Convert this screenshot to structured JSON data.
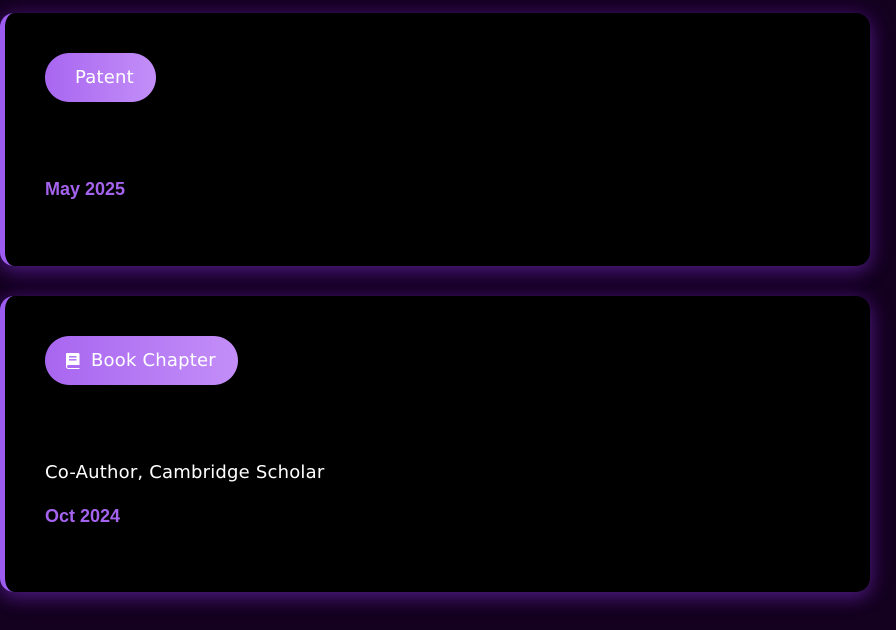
{
  "publications": [
    {
      "type_label": "Patent",
      "date": "May 2025"
    },
    {
      "type_label": "Book Chapter",
      "icon": "book-icon",
      "subtitle": "Co-Author, Cambridge Scholar",
      "date": "Oct 2024"
    }
  ],
  "colors": {
    "page_background": "#14001f",
    "card_background": "#000000",
    "accent": "#9d5cf0",
    "badge_start": "#a866f0",
    "badge_end": "#c38ef8",
    "date_text": "#a463ee",
    "body_text": "#ffffff"
  }
}
